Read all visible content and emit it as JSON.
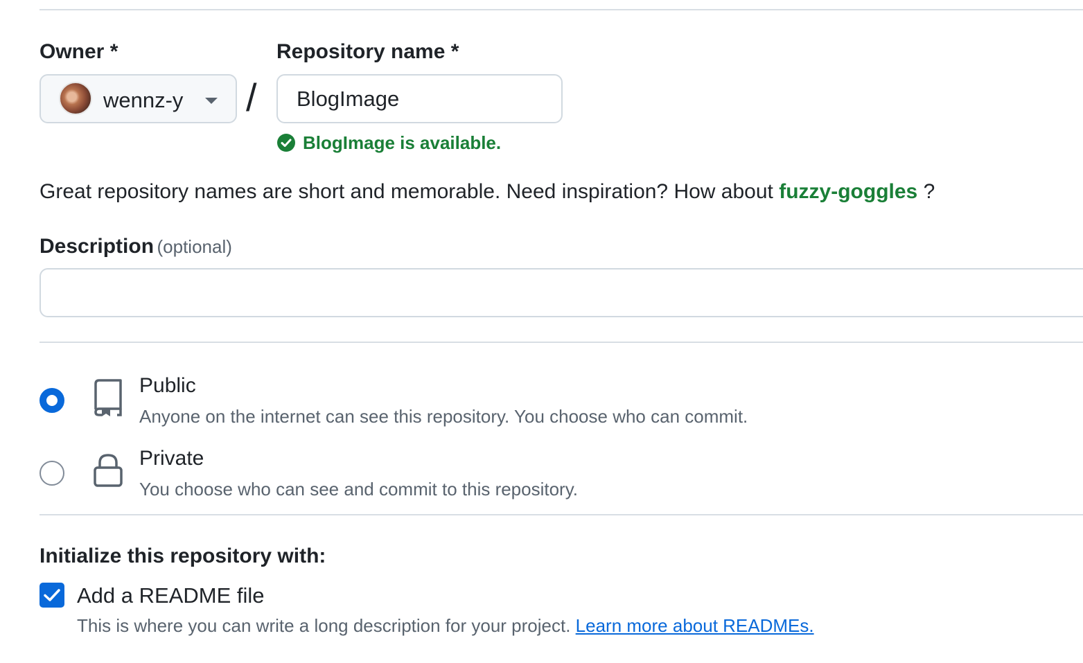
{
  "owner": {
    "label": "Owner *",
    "value": "wennz-y"
  },
  "separator": "/",
  "repository_name": {
    "label": "Repository name *",
    "value": "BlogImage",
    "availability": "BlogImage is available."
  },
  "inspiration": {
    "text": "Great repository names are short and memorable. Need inspiration? How about",
    "suggestion": "fuzzy-goggles",
    "suffix": "?"
  },
  "description": {
    "label": "Description",
    "optional": "(optional)",
    "value": ""
  },
  "visibility": {
    "selected": "public",
    "options": [
      {
        "title": "Public",
        "description": "Anyone on the internet can see this repository. You choose who can commit."
      },
      {
        "title": "Private",
        "description": "You choose who can see and commit to this repository."
      }
    ]
  },
  "initialize": {
    "heading": "Initialize this repository with:",
    "readme": {
      "checked": true,
      "title": "Add a README file",
      "description": "This is where you can write a long description for your project.",
      "link": "Learn more about READMEs."
    }
  },
  "colors": {
    "accent": "#0969da",
    "success": "#1a7f37",
    "border": "#d1d9e0",
    "muted": "#59636e"
  }
}
